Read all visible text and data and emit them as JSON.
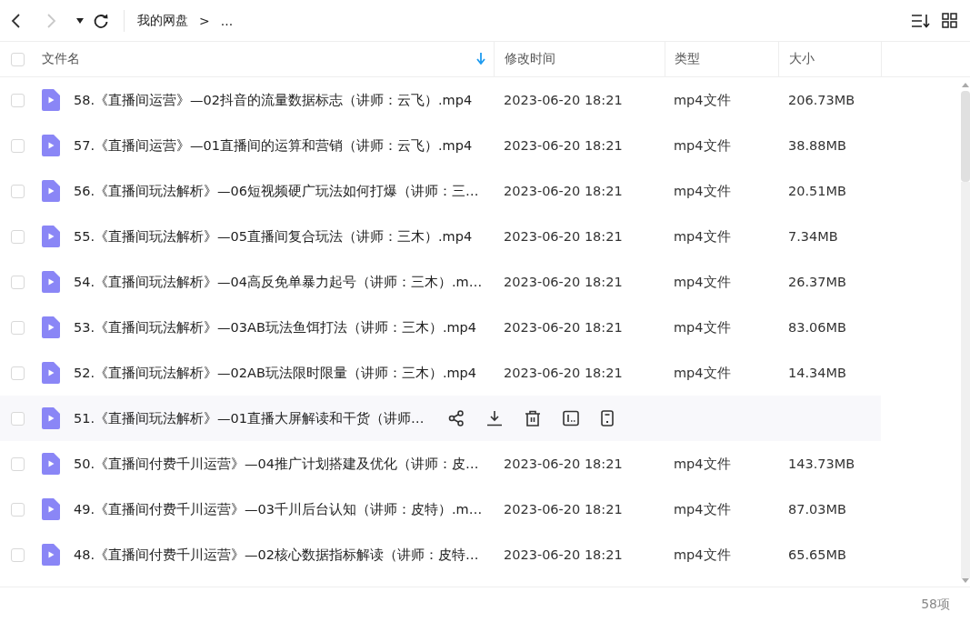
{
  "toolbar": {
    "back_disabled": false,
    "forward_disabled": true,
    "breadcrumb": [
      {
        "label": "我的网盘"
      },
      {
        "label": "..."
      }
    ],
    "separator": ">"
  },
  "table": {
    "select_all_checked": false,
    "columns": [
      {
        "label": "文件名",
        "sorted": true
      },
      {
        "label": "修改时间",
        "sorted": false
      },
      {
        "label": "类型",
        "sorted": false
      },
      {
        "label": "大小",
        "sorted": false
      }
    ],
    "rows": [
      {
        "name": "58.《直播间运营》—02抖音的流量数据标志（讲师：云飞）.mp4",
        "modified": "2023-06-20 18:21",
        "type": "mp4文件",
        "size": "206.73MB",
        "hovered": false,
        "checked": false
      },
      {
        "name": "57.《直播间运营》—01直播间的运算和营销（讲师：云飞）.mp4",
        "modified": "2023-06-20 18:21",
        "type": "mp4文件",
        "size": "38.88MB",
        "hovered": false,
        "checked": false
      },
      {
        "name": "56.《直播间玩法解析》—06短视频硬广玩法如何打爆（讲师：三…",
        "modified": "2023-06-20 18:21",
        "type": "mp4文件",
        "size": "20.51MB",
        "hovered": false,
        "checked": false
      },
      {
        "name": "55.《直播间玩法解析》—05直播间复合玩法（讲师：三木）.mp4",
        "modified": "2023-06-20 18:21",
        "type": "mp4文件",
        "size": "7.34MB",
        "hovered": false,
        "checked": false
      },
      {
        "name": "54.《直播间玩法解析》—04高反免单暴力起号（讲师：三木）.m…",
        "modified": "2023-06-20 18:21",
        "type": "mp4文件",
        "size": "26.37MB",
        "hovered": false,
        "checked": false
      },
      {
        "name": "53.《直播间玩法解析》—03AB玩法鱼饵打法（讲师：三木）.mp4",
        "modified": "2023-06-20 18:21",
        "type": "mp4文件",
        "size": "83.06MB",
        "hovered": false,
        "checked": false
      },
      {
        "name": "52.《直播间玩法解析》—02AB玩法限时限量（讲师：三木）.mp4",
        "modified": "2023-06-20 18:21",
        "type": "mp4文件",
        "size": "14.34MB",
        "hovered": false,
        "checked": false
      },
      {
        "name": "51.《直播间玩法解析》—01直播大屏解读和干货（讲师…",
        "hovered": true,
        "checked": false
      },
      {
        "name": "50.《直播间付费千川运营》—04推广计划搭建及优化（讲师：皮…",
        "modified": "2023-06-20 18:21",
        "type": "mp4文件",
        "size": "143.73MB",
        "hovered": false,
        "checked": false
      },
      {
        "name": "49.《直播间付费千川运营》—03千川后台认知（讲师：皮特）.m…",
        "modified": "2023-06-20 18:21",
        "type": "mp4文件",
        "size": "87.03MB",
        "hovered": false,
        "checked": false
      },
      {
        "name": "48.《直播间付费千川运营》—02核心数据指标解读（讲师：皮特…",
        "modified": "2023-06-20 18:21",
        "type": "mp4文件",
        "size": "65.65MB",
        "hovered": false,
        "checked": false
      }
    ]
  },
  "footer": {
    "count": "58项"
  }
}
